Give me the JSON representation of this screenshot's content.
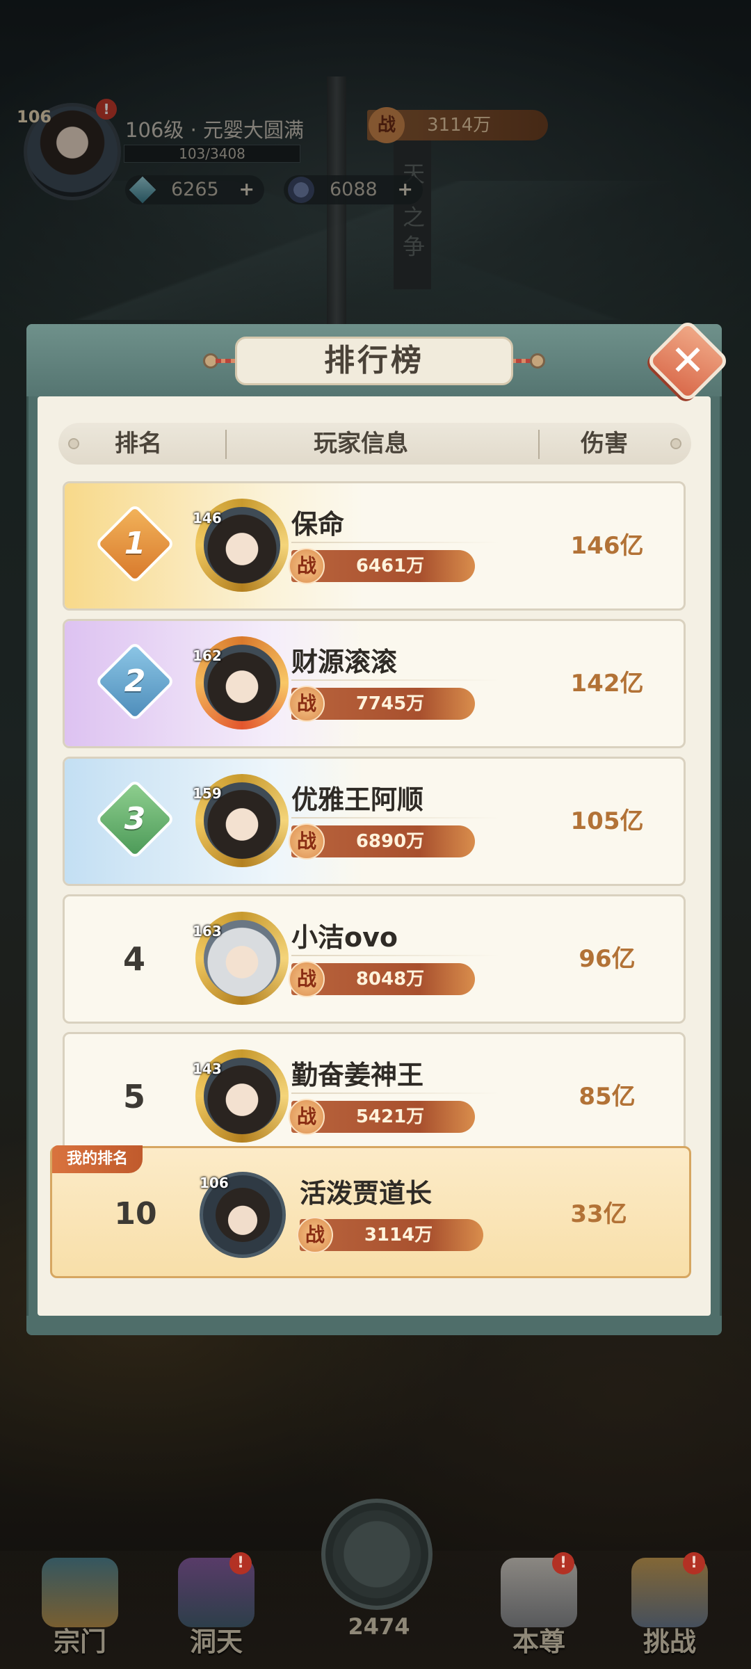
{
  "hud": {
    "level": "106",
    "badge": "!",
    "title": "106级 · 元婴大圆满",
    "exp": "103/3408",
    "gems": "6265",
    "coins": "6088",
    "plus": "+",
    "power_icon": "战",
    "power": "3114万",
    "banner": "天 之争"
  },
  "panel": {
    "title": "排行榜",
    "close": "✕",
    "columns": [
      "排名",
      "玩家信息",
      "伤害"
    ]
  },
  "rows": [
    {
      "rank": "1",
      "level": "146",
      "name": "保命",
      "power": "6461万",
      "damage": "146亿"
    },
    {
      "rank": "2",
      "level": "162",
      "name": "财源滚滚",
      "power": "7745万",
      "damage": "142亿"
    },
    {
      "rank": "3",
      "level": "159",
      "name": "优雅王阿顺",
      "power": "6890万",
      "damage": "105亿"
    },
    {
      "rank": "4",
      "level": "163",
      "name": "小洁ovo",
      "power": "8048万",
      "damage": "96亿"
    },
    {
      "rank": "5",
      "level": "143",
      "name": "勤奋姜神王",
      "power": "5421万",
      "damage": "85亿"
    }
  ],
  "power_icon": "战",
  "my_rank": {
    "tag": "我的排名",
    "rank": "10",
    "level": "106",
    "name": "活泼贾道长",
    "power": "3114万",
    "damage": "33亿"
  },
  "nav": {
    "items": [
      "宗门",
      "洞天",
      "本尊",
      "挑战"
    ],
    "center_value": "2474",
    "badge": "!"
  },
  "colors": {
    "gold_rank": "#e39a3c",
    "silver_rank": "#6aa6c8",
    "bronze_rank": "#5aa75e",
    "damage_text": "#b27236",
    "panel_frame": "#4f6e6a"
  }
}
